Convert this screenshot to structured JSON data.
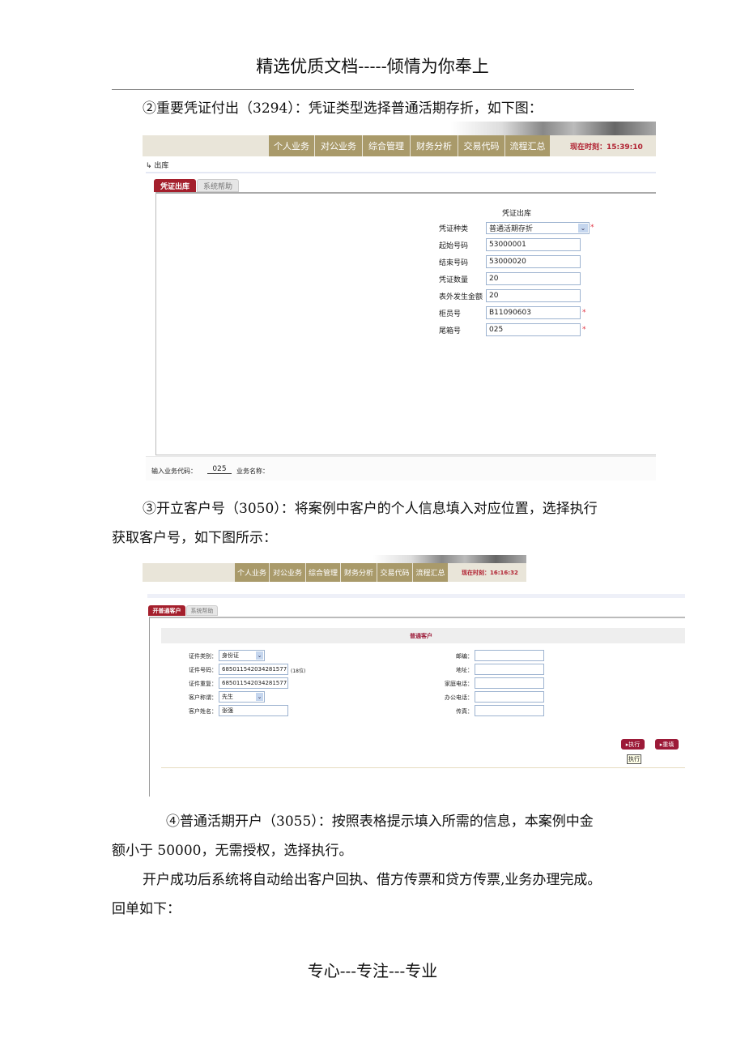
{
  "header": "精选优质文档-----倾情为你奉上",
  "footer": "专心---专注---专业",
  "paragraphs": {
    "p2": "②重要凭证付出（3294）：凭证类型选择普通活期存折，如下图：",
    "p3_line1": "③开立客户号（3050）：将案例中客户的个人信息填入对应位置，选择执行",
    "p3_line2": "获取客户号，如下图所示：",
    "p4_line1": "④普通活期开户（3055）：按照表格提示填入所需的信息，本案例中金",
    "p4_line2": "额小于 50000，无需授权，选择执行。",
    "p5_line1": "开户成功后系统将自动给出客户回执、借方传票和贷方传票,业务办理完成。",
    "p5_line2": "回单如下："
  },
  "nav": [
    "个人业务",
    "对公业务",
    "综合管理",
    "财务分析",
    "交易代码",
    "流程汇总"
  ],
  "shot1": {
    "time": "现在时刻：15:39:10",
    "breadcrumb": "出库",
    "tabs": [
      "凭证出库",
      "系统帮助"
    ],
    "form_title": "凭证出库",
    "fields": [
      {
        "label": "凭证种类",
        "value": "普通活期存折",
        "type": "select",
        "required": true
      },
      {
        "label": "起始号码",
        "value": "53000001",
        "required": false
      },
      {
        "label": "结束号码",
        "value": "53000020",
        "required": false
      },
      {
        "label": "凭证数量",
        "value": "20",
        "required": false
      },
      {
        "label": "表外发生金额",
        "value": "20",
        "required": false
      },
      {
        "label": "柜员号",
        "value": "B11090603",
        "required": true
      },
      {
        "label": "尾箱号",
        "value": "025",
        "required": true
      }
    ],
    "code_label": "输入业务代码：",
    "code_value": "025",
    "name_label": "业务名称："
  },
  "shot2": {
    "time": "现在时刻：16:16:32",
    "tabs": [
      "开普通客户",
      "系统帮助"
    ],
    "section_title": "普通客户",
    "left_fields": [
      {
        "label": "证件类别：",
        "value": "身份证",
        "type": "select"
      },
      {
        "label": "证件号码：",
        "value": "685011542034281577",
        "hint": "(18位)"
      },
      {
        "label": "证件重复：",
        "value": "685011542034281577"
      },
      {
        "label": "客户称谓：",
        "value": "先生",
        "type": "select"
      },
      {
        "label": "客户姓名：",
        "value": "张强"
      }
    ],
    "right_fields": [
      {
        "label": "邮编：",
        "value": ""
      },
      {
        "label": "地址：",
        "value": ""
      },
      {
        "label": "家庭电话：",
        "value": ""
      },
      {
        "label": "办公电话：",
        "value": ""
      },
      {
        "label": "传真：",
        "value": ""
      }
    ],
    "execute_label": "执行",
    "reset_label": "重填",
    "tooltip": "执行"
  }
}
